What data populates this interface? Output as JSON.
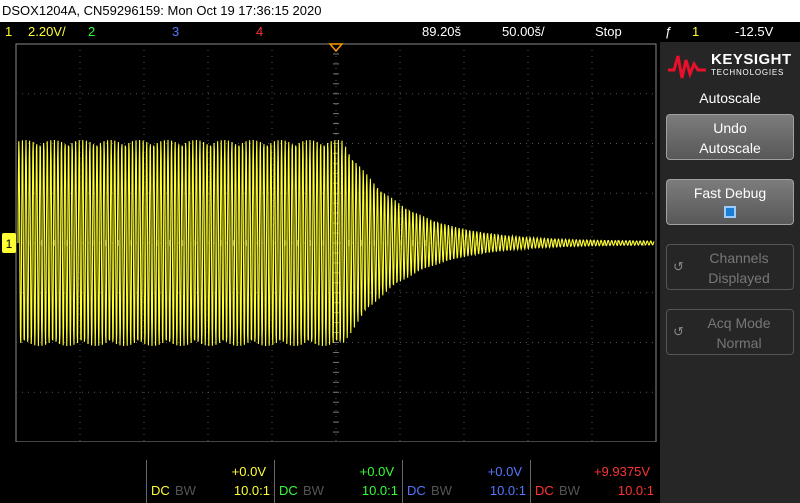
{
  "title": "DSOX1204A, CN59296159: Mon Oct 19 17:36:15 2020",
  "status": {
    "ch1_num": "1",
    "ch1_scale": "2.20V/",
    "ch2_num": "2",
    "ch3_num": "3",
    "ch4_num": "4",
    "time_delay": "89.20š",
    "time_scale": "50.00š/",
    "run_state": "Stop",
    "trigger_icon": "ƒ",
    "trigger_source": "1",
    "trigger_level": "-12.5V"
  },
  "colors": {
    "ch1": "#ffff33",
    "ch2": "#33ff33",
    "ch3": "#5577ff",
    "ch4": "#ff3333",
    "trigger": "#ff9900",
    "grid": "#555555"
  },
  "brand": {
    "name": "KEYSIGHT",
    "sub": "TECHNOLOGIES"
  },
  "menu": {
    "title": "Autoscale",
    "undo_line1": "Undo",
    "undo_line2": "Autoscale",
    "fast_debug": "Fast Debug",
    "channels_line1": "Channels",
    "channels_line2": "Displayed",
    "acq_line1": "Acq Mode",
    "acq_line2": "Normal"
  },
  "channels": [
    {
      "offset": "+0.0V",
      "coupling": "DC",
      "bw": "BW",
      "probe": "10.0:1"
    },
    {
      "offset": "+0.0V",
      "coupling": "DC",
      "bw": "BW",
      "probe": "10.0:1"
    },
    {
      "offset": "+0.0V",
      "coupling": "DC",
      "bw": "BW",
      "probe": "10.0:1"
    },
    {
      "offset": "+9.9375V",
      "coupling": "DC",
      "bw": "BW",
      "probe": "10.0:1"
    }
  ],
  "ground_marker": "1"
}
